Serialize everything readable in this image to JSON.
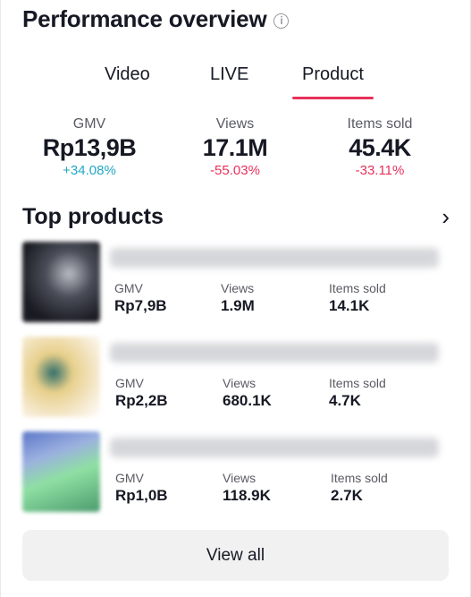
{
  "header": {
    "title": "Performance overview",
    "info_icon": "info-circle-icon"
  },
  "tabs": [
    {
      "label": "Video",
      "active": false
    },
    {
      "label": "LIVE",
      "active": false
    },
    {
      "label": "Product",
      "active": true
    }
  ],
  "metrics": [
    {
      "label": "GMV",
      "value": "Rp13,9B",
      "delta": "+34.08%",
      "trend": "up"
    },
    {
      "label": "Views",
      "value": "17.1M",
      "delta": "-55.03%",
      "trend": "down"
    },
    {
      "label": "Items sold",
      "value": "45.4K",
      "delta": "-33.11%",
      "trend": "down"
    }
  ],
  "top_products": {
    "title": "Top products",
    "chevron_icon": "chevron-right-icon",
    "items": [
      {
        "gmv_label": "GMV",
        "gmv": "Rp7,9B",
        "views_label": "Views",
        "views": "1.9M",
        "sold_label": "Items sold",
        "sold": "14.1K"
      },
      {
        "gmv_label": "GMV",
        "gmv": "Rp2,2B",
        "views_label": "Views",
        "views": "680.1K",
        "sold_label": "Items sold",
        "sold": "4.7K"
      },
      {
        "gmv_label": "GMV",
        "gmv": "Rp1,0B",
        "views_label": "Views",
        "views": "118.9K",
        "sold_label": "Items sold",
        "sold": "2.7K"
      }
    ]
  },
  "view_all_label": "View all",
  "colors": {
    "accent": "#e8305a",
    "positive": "#23a7c6",
    "negative": "#e8305a",
    "button_bg": "#f1f1f2"
  }
}
